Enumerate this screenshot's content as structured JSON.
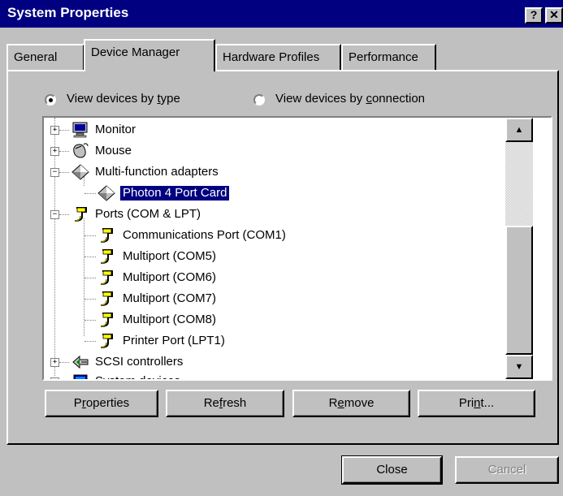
{
  "window": {
    "title": "System Properties",
    "help_glyph": "?",
    "close_glyph": "✕"
  },
  "tabs": [
    {
      "label": "General",
      "active": false
    },
    {
      "label": "Device Manager",
      "active": true
    },
    {
      "label": "Hardware Profiles",
      "active": false
    },
    {
      "label": "Performance",
      "active": false
    }
  ],
  "view_options": {
    "by_type": {
      "pre": "View devices by ",
      "accel": "t",
      "post": "ype",
      "selected": true
    },
    "by_connection": {
      "pre": "View devices by ",
      "accel": "c",
      "post": "onnection",
      "selected": false
    }
  },
  "tree": {
    "nodes": [
      {
        "label": "Monitor",
        "icon": "monitor-icon",
        "level": 0,
        "expander": "+"
      },
      {
        "label": "Mouse",
        "icon": "mouse-icon",
        "level": 0,
        "expander": "+"
      },
      {
        "label": "Multi-function adapters",
        "icon": "diamond-adapter-icon",
        "level": 0,
        "expander": "-"
      },
      {
        "label": "Photon 4 Port Card",
        "icon": "diamond-adapter-icon",
        "level": 1,
        "selected": true
      },
      {
        "label": "Ports (COM & LPT)",
        "icon": "port-plug-icon",
        "level": 0,
        "expander": "-"
      },
      {
        "label": "Communications Port (COM1)",
        "icon": "port-plug-icon",
        "level": 1
      },
      {
        "label": "Multiport (COM5)",
        "icon": "port-plug-icon",
        "level": 1
      },
      {
        "label": "Multiport (COM6)",
        "icon": "port-plug-icon",
        "level": 1
      },
      {
        "label": "Multiport (COM7)",
        "icon": "port-plug-icon",
        "level": 1
      },
      {
        "label": "Multiport (COM8)",
        "icon": "port-plug-icon",
        "level": 1
      },
      {
        "label": "Printer Port (LPT1)",
        "icon": "port-plug-icon",
        "level": 1
      },
      {
        "label": "SCSI controllers",
        "icon": "scsi-icon",
        "level": 0,
        "expander": "+"
      },
      {
        "label": "System devices",
        "icon": "system-device-icon",
        "level": 0,
        "expander": "+"
      }
    ]
  },
  "scrollbar": {
    "up_glyph": "▲",
    "down_glyph": "▼",
    "position_fraction": 1.0
  },
  "panel_buttons": {
    "properties": {
      "pre": "P",
      "accel": "r",
      "post": "operties"
    },
    "refresh": {
      "pre": "Re",
      "accel": "f",
      "post": "resh"
    },
    "remove": {
      "pre": "R",
      "accel": "e",
      "post": "move"
    },
    "print": {
      "pre": "Pri",
      "accel": "n",
      "post": "t..."
    }
  },
  "dialog_buttons": {
    "close": "Close",
    "cancel": "Cancel"
  },
  "colors": {
    "face": "#c0c0c0",
    "titlebar": "#000080",
    "selection": "#000080"
  }
}
